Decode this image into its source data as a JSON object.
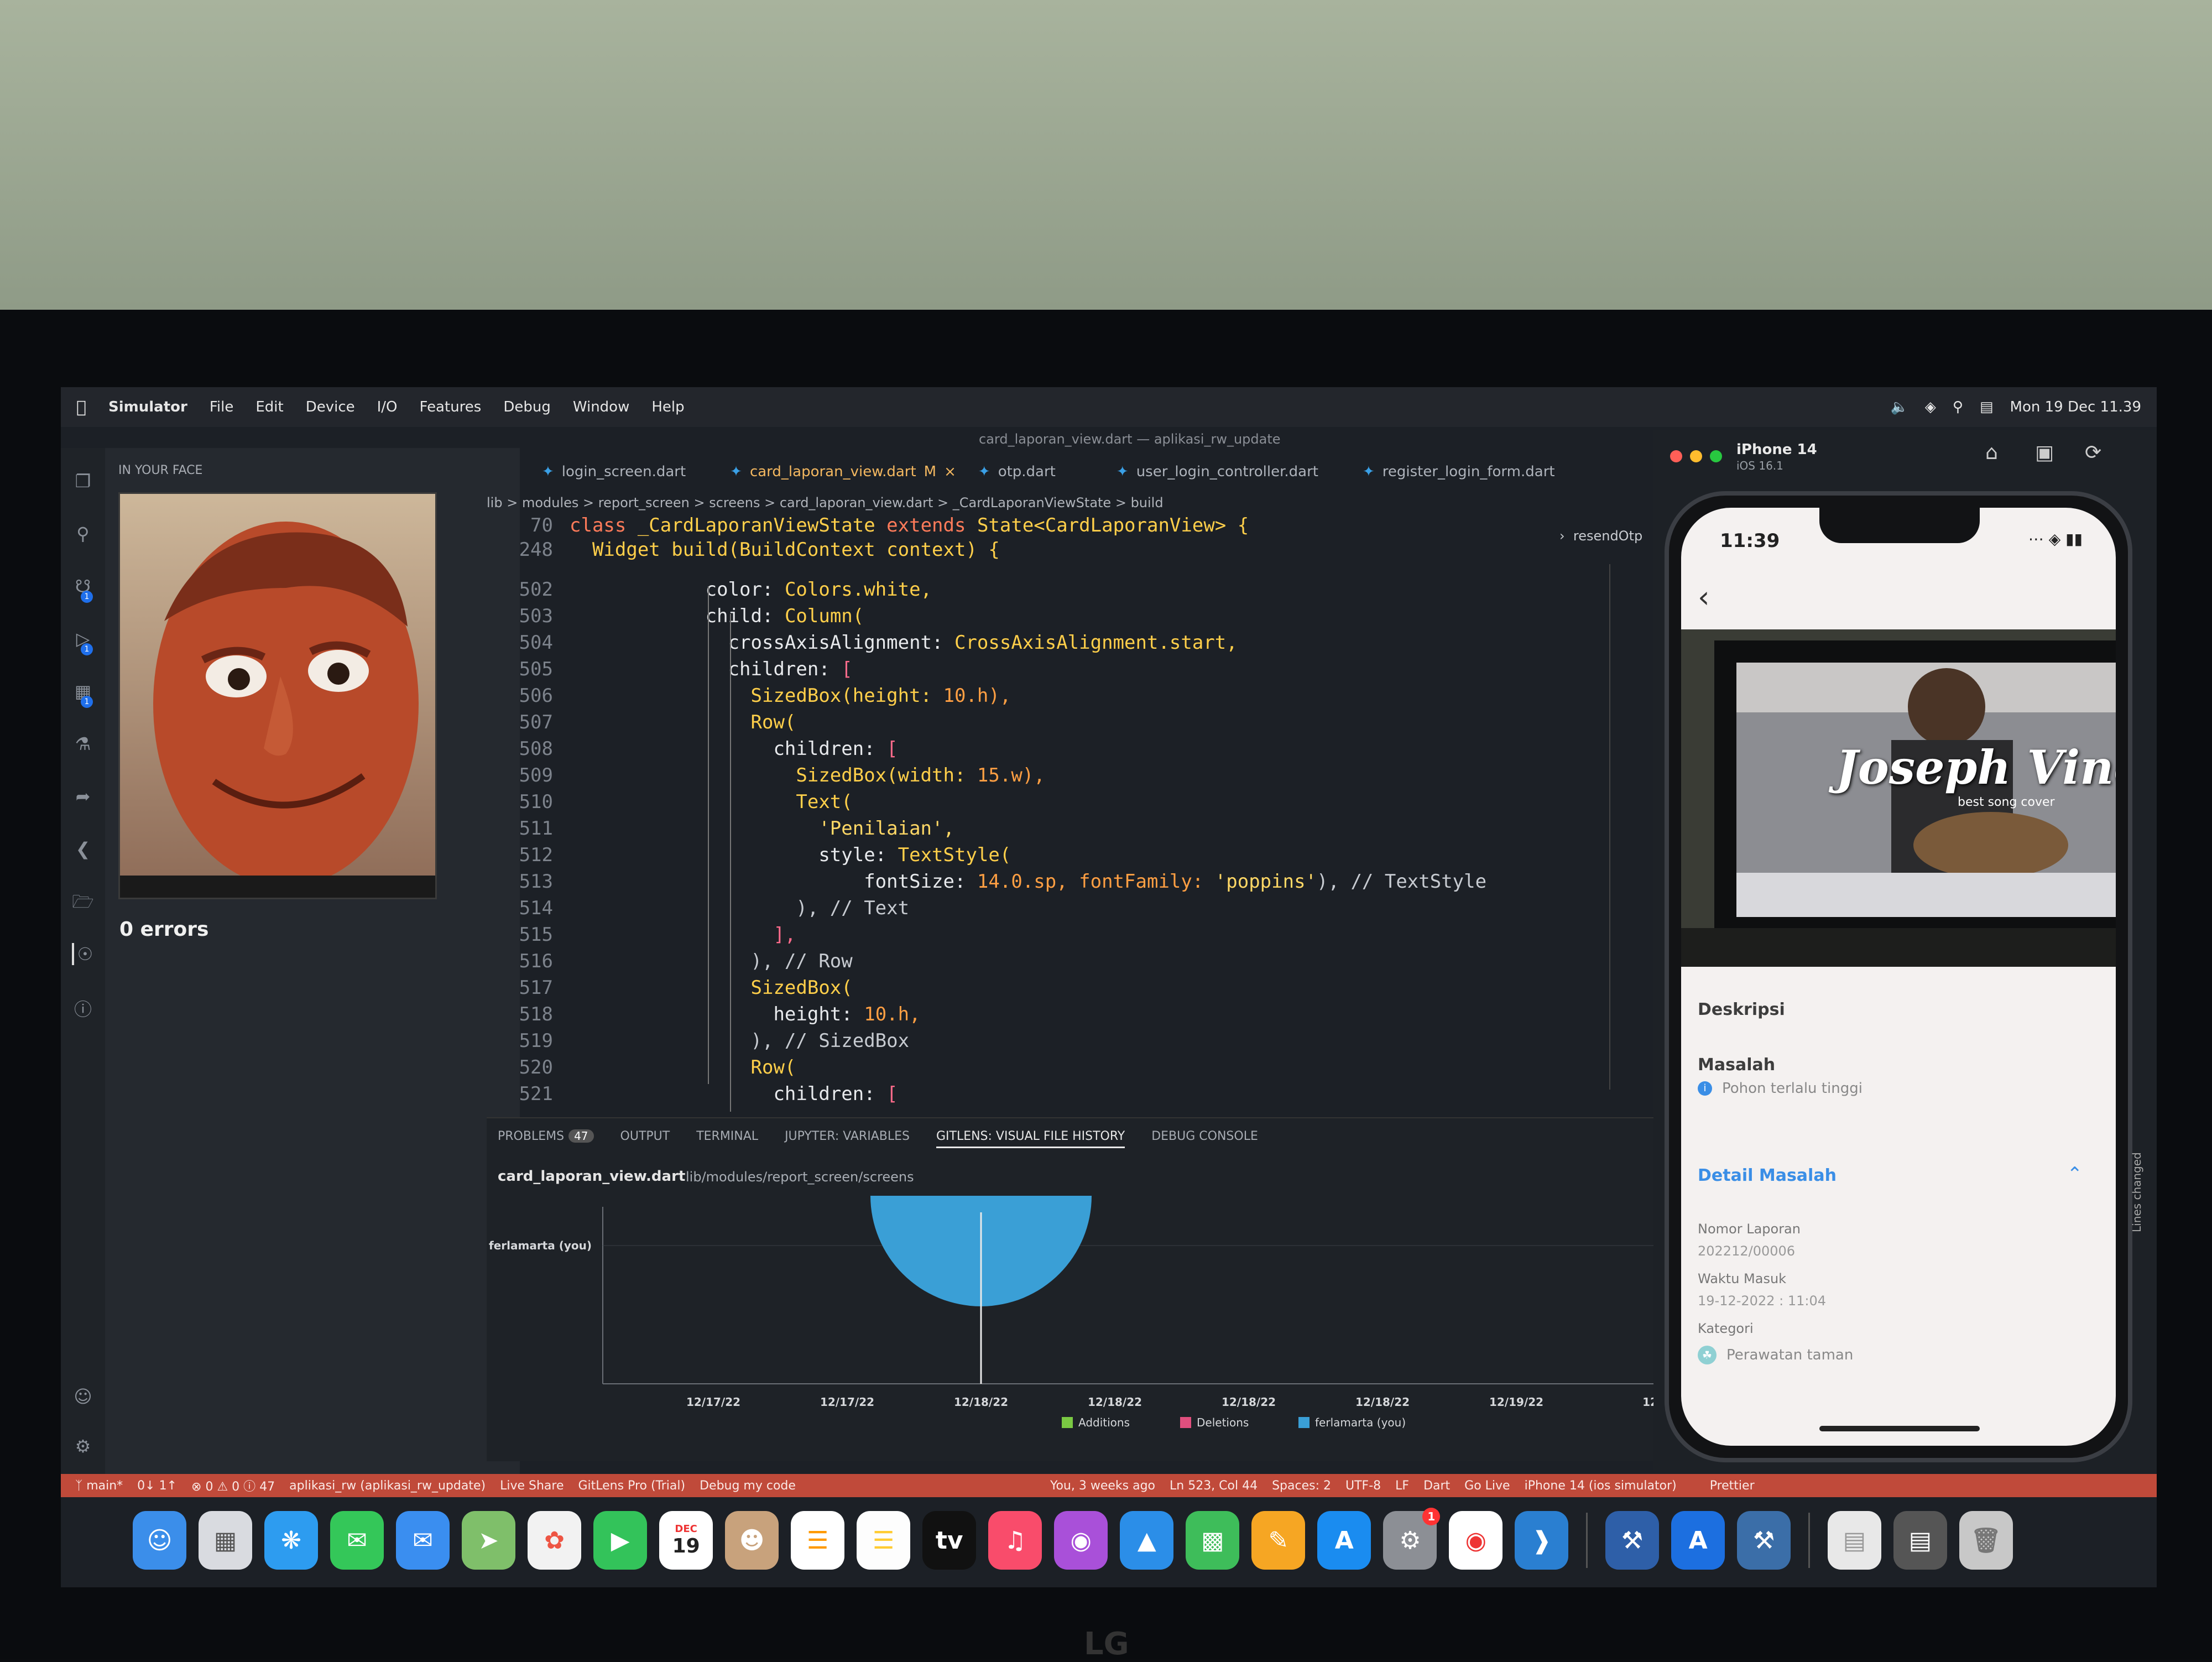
{
  "menubar": {
    "app": "Simulator",
    "items": [
      "File",
      "Edit",
      "Device",
      "I/O",
      "Features",
      "Debug",
      "Window",
      "Help"
    ],
    "clock": "Mon 19 Dec 11.39"
  },
  "window_title": "card_laporan_view.dart — aplikasi_rw_update",
  "side": {
    "header": "IN YOUR FACE",
    "errors": "0 errors"
  },
  "tabs": [
    {
      "label": "login_screen.dart"
    },
    {
      "label": "card_laporan_view.dart",
      "suffix": "M"
    },
    {
      "label": "otp.dart"
    },
    {
      "label": "user_login_controller.dart"
    },
    {
      "label": "register_login_form.dart"
    }
  ],
  "breadcrumb": "lib > modules > report_screen > screens > card_laporan_view.dart > _CardLaporanViewState > build",
  "outline_item": "resendOtp",
  "code": {
    "l70": {
      "n": "70",
      "a": "class ",
      "b": "_CardLaporanViewState ",
      "c": "extends ",
      "d": "State<CardLaporanView> {"
    },
    "l248": {
      "n": "248",
      "a": "  Widget ",
      "b": "build(BuildContext context) {"
    },
    "l502": {
      "n": "502",
      "a": "            color: ",
      "b": "Colors.white,"
    },
    "l503": {
      "n": "503",
      "a": "            child: ",
      "b": "Column("
    },
    "l504": {
      "n": "504",
      "a": "              crossAxisAlignment: ",
      "b": "CrossAxisAlignment.start,"
    },
    "l505": {
      "n": "505",
      "a": "              children: ",
      "b": "["
    },
    "l506": {
      "n": "506",
      "a": "                SizedBox(height: ",
      "b": "10.h),"
    },
    "l507": {
      "n": "507",
      "a": "                Row("
    },
    "l508": {
      "n": "508",
      "a": "                  children: ",
      "b": "["
    },
    "l509": {
      "n": "509",
      "a": "                    SizedBox(width: ",
      "b": "15.w),"
    },
    "l510": {
      "n": "510",
      "a": "                    Text("
    },
    "l511": {
      "n": "511",
      "a": "                      'Penilaian',"
    },
    "l512": {
      "n": "512",
      "a": "                      style: ",
      "b": "TextStyle("
    },
    "l513": {
      "n": "513",
      "a": "                          fontSize: ",
      "b": "14.0.sp, fontFamily: ",
      "c": "'poppins'",
      "d": "), // TextStyle"
    },
    "l514": {
      "n": "514",
      "a": "                    ), // Text"
    },
    "l515": {
      "n": "515",
      "a": "                  ],"
    },
    "l516": {
      "n": "516",
      "a": "                ), // Row"
    },
    "l517": {
      "n": "517",
      "a": "                SizedBox("
    },
    "l518": {
      "n": "518",
      "a": "                  height: ",
      "b": "10.h,"
    },
    "l519": {
      "n": "519",
      "a": "                ), // SizedBox"
    },
    "l520": {
      "n": "520",
      "a": "                Row("
    },
    "l521": {
      "n": "521",
      "a": "                  children: ",
      "b": "["
    }
  },
  "panel": {
    "tabs": [
      "PROBLEMS",
      "OUTPUT",
      "TERMINAL",
      "JUPYTER: VARIABLES",
      "GITLENS: VISUAL FILE HISTORY",
      "DEBUG CONSOLE"
    ],
    "problems_count": "47",
    "file": "card_laporan_view.dart",
    "path": "lib/modules/report_screen/screens"
  },
  "chart_data": {
    "type": "scatter",
    "categories": [
      "12/17/22",
      "12/17/22",
      "12/18/22",
      "12/18/22",
      "12/18/22",
      "12/18/22",
      "12/19/22",
      "12"
    ],
    "y_categories": [
      "ferlamarta (you)"
    ],
    "legend": [
      "Additions",
      "Deletions",
      "ferlamarta (you)"
    ],
    "legend_colors": [
      "#7ac943",
      "#e04f7e",
      "#3a9fd6"
    ],
    "points": [
      {
        "x": "12/18/22",
        "y": "ferlamarta (you)"
      }
    ]
  },
  "status": {
    "branch": "main*",
    "sync": "0↓ 1↑",
    "problems": "0 ⚠ 0 ⓘ 47",
    "project": "aplikasi_rw (aplikasi_rw_update)",
    "liveshare": "Live Share",
    "gitlens": "GitLens Pro (Trial)",
    "debug": "Debug my code",
    "blame": "You, 3 weeks ago",
    "position": "Ln 523, Col 44",
    "spaces": "Spaces: 2",
    "encoding": "UTF-8",
    "eol": "LF",
    "lang": "Dart",
    "golive": "Go Live",
    "device": "iPhone 14 (ios simulator)",
    "prettier": "Prettier"
  },
  "simulator": {
    "title": "iPhone 14",
    "subtitle": "iOS 16.1",
    "time": "11:39",
    "video_title": "Joseph Vincent",
    "video_sub": "best song cover",
    "deskripsi": "Deskripsi",
    "masalah_label": "Masalah",
    "masalah_value": "Pohon terlalu tinggi",
    "detail": "Detail Masalah",
    "nomor_label": "Nomor Laporan",
    "nomor_value": "202212/00006",
    "waktu_label": "Waktu Masuk",
    "waktu_value": "19-12-2022 : 11:04",
    "kategori_label": "Kategori",
    "kategori_value": "Perawatan taman",
    "lines_changed": "Lines changed"
  },
  "dock": {
    "calendar_month": "DEC",
    "calendar_day": "19",
    "tv_label": "tv",
    "notif": "1"
  },
  "monitor_brand": "LG"
}
